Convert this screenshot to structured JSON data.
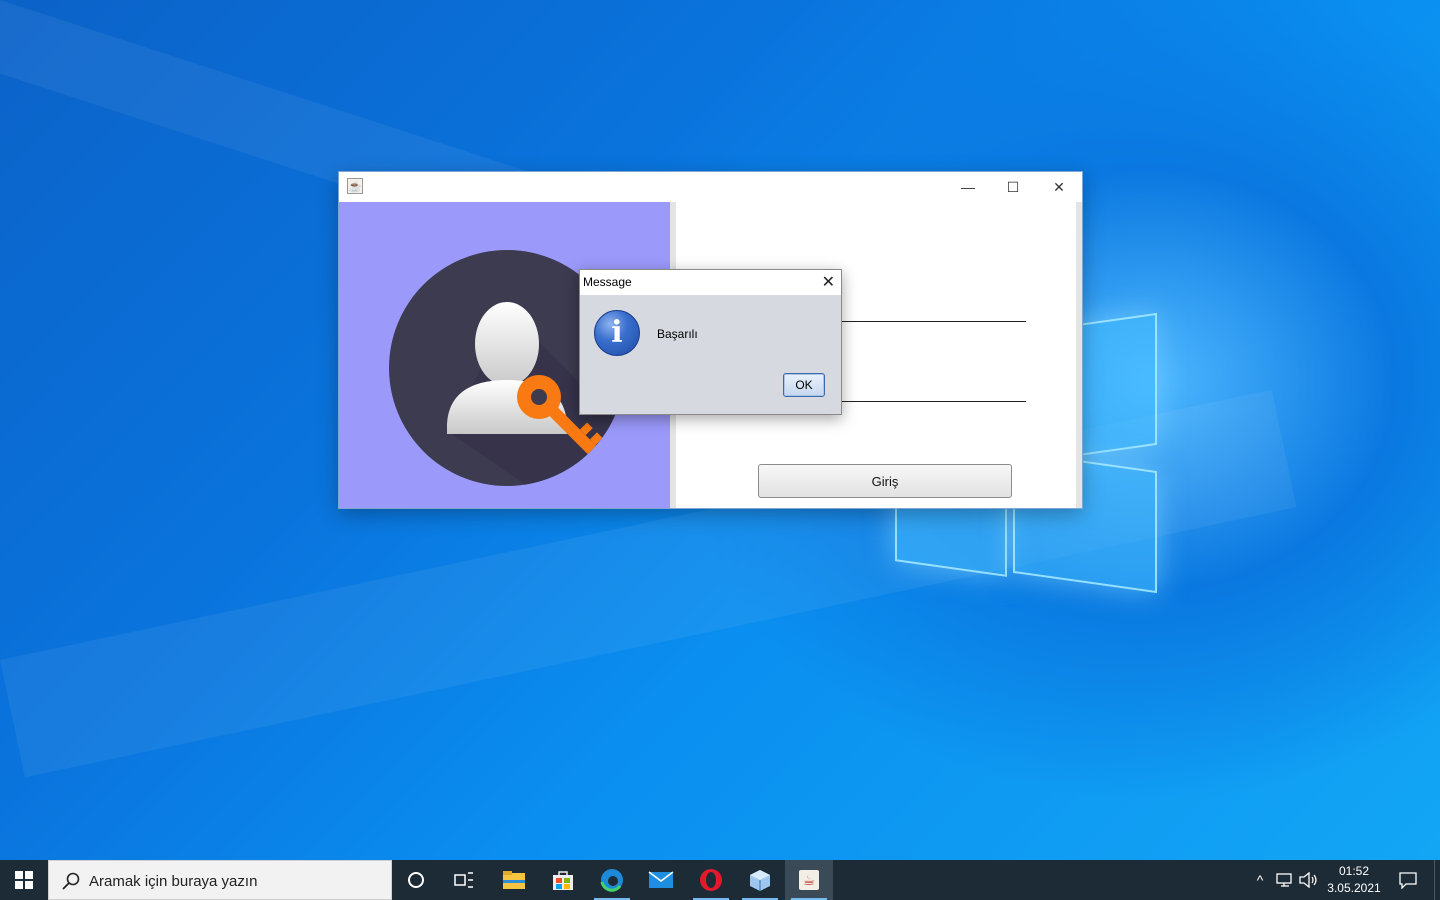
{
  "desktop": {
    "colors": {
      "background": "#0a74dd",
      "logo_glow": "#46beff"
    }
  },
  "app_window": {
    "title": "",
    "icon": "java-icon",
    "controls": {
      "minimize": "—",
      "maximize": "☐",
      "close": "✕"
    },
    "left_panel_color": "#9b99fa",
    "illustration": "user-key-icon",
    "login_button_label": "Giriş"
  },
  "dialog": {
    "title": "Message",
    "close": "✕",
    "icon": "info-icon",
    "icon_glyph": "i",
    "message": "Başarılı",
    "ok_label": "OK"
  },
  "taskbar": {
    "search_placeholder": "Aramak için buraya yazın",
    "apps": [
      "cortana-icon",
      "task-view-icon",
      "file-explorer-icon",
      "store-icon",
      "edge-icon",
      "mail-icon",
      "opera-icon",
      "virtualbox-icon",
      "java-icon"
    ],
    "tray": {
      "chevron": "^",
      "network": "network-icon",
      "volume": "volume-icon"
    },
    "time": "01:52",
    "date": "3.05.2021"
  }
}
